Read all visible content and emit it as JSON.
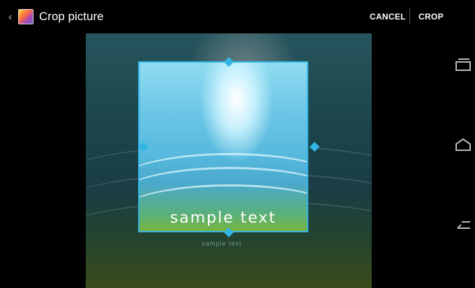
{
  "header": {
    "up_icon": "chevron-left-icon",
    "app_icon": "gallery-icon",
    "title": "Crop picture",
    "cancel_label": "CANCEL",
    "crop_label": "CROP"
  },
  "image": {
    "main_text": "sample text",
    "faint_text": "sample text"
  },
  "navbar": {
    "icons": [
      "recent-apps-icon",
      "home-icon",
      "back-icon"
    ]
  },
  "colors": {
    "accent": "#33b5e5"
  }
}
